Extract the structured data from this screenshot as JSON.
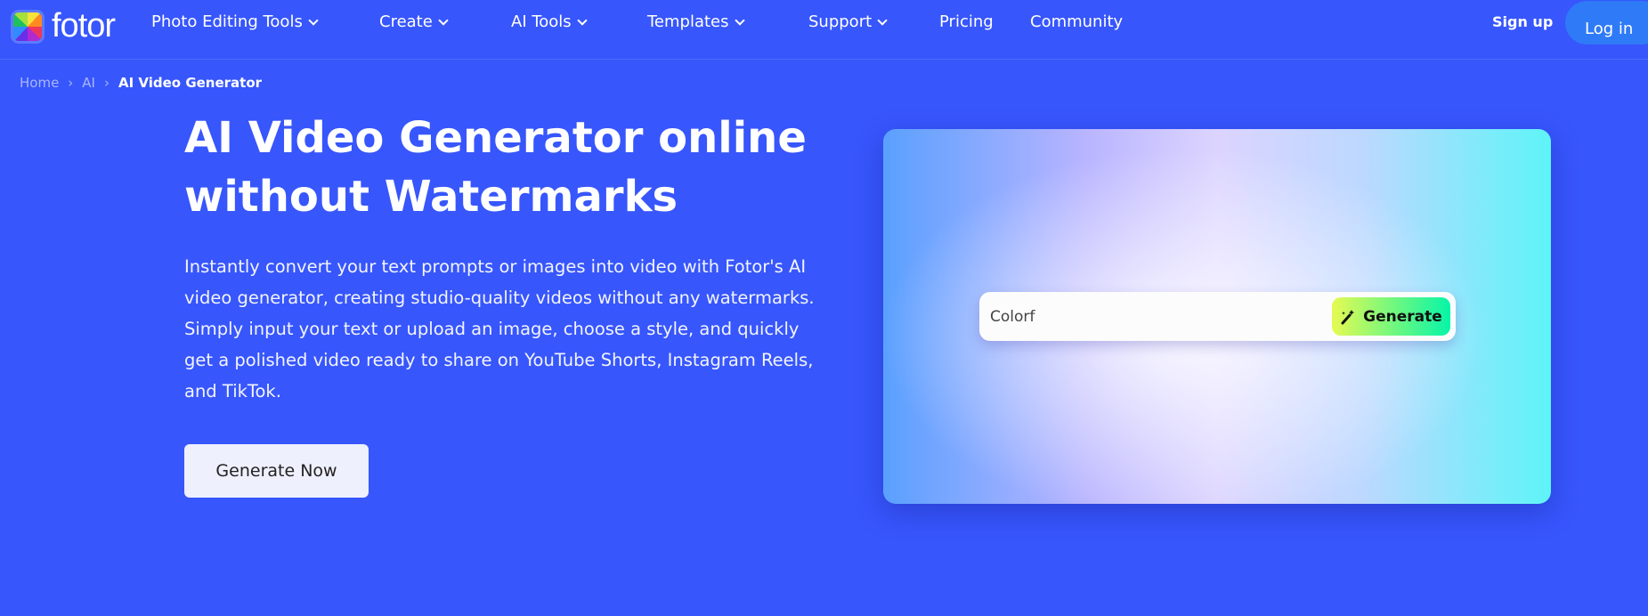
{
  "brand": {
    "name": "fotor"
  },
  "nav": {
    "items": [
      {
        "label": "Photo Editing Tools",
        "dropdown": true
      },
      {
        "label": "Create",
        "dropdown": true
      },
      {
        "label": "AI Tools",
        "dropdown": true
      },
      {
        "label": "Templates",
        "dropdown": true
      },
      {
        "label": "Support",
        "dropdown": true
      },
      {
        "label": "Pricing",
        "dropdown": false
      },
      {
        "label": "Community",
        "dropdown": false
      }
    ],
    "signup": "Sign up",
    "login": "Log in"
  },
  "breadcrumb": [
    "Home",
    "AI",
    "AI Video Generator"
  ],
  "hero": {
    "title": "AI Video Generator online without Watermarks",
    "description": "Instantly convert your text prompts or images into video with Fotor's AI video generator, creating studio-quality videos without any watermarks. Simply input your text or upload an image, choose a style, and quickly get a polished video ready to share on YouTube Shorts, Instagram Reels, and TikTok.",
    "cta": "Generate Now"
  },
  "demo": {
    "prompt_value": "Colorf",
    "generate_label": "Generate",
    "icon": "magic-wand-icon"
  },
  "colors": {
    "background": "#3756fc",
    "login": "#2f7af6"
  }
}
